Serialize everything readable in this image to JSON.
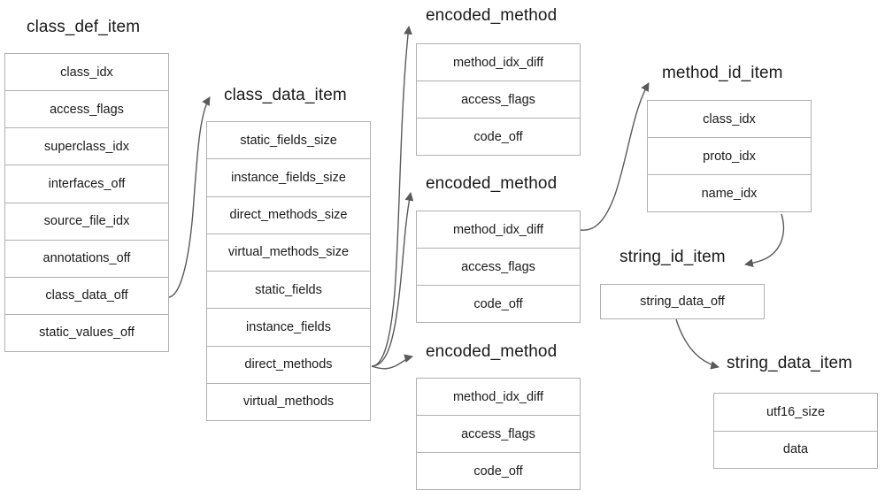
{
  "diagram": {
    "title_hidden": "",
    "accent_line_color": "#5a5a5a",
    "box_border_color": "#b0b0b0",
    "text_color": "#1a1a1a"
  },
  "structs": [
    {
      "id": "class_def_item",
      "title": "class_def_item",
      "fields": [
        "class_idx",
        "access_flags",
        "superclass_idx",
        "interfaces_off",
        "source_file_idx",
        "annotations_off",
        "class_data_off",
        "static_values_off"
      ]
    },
    {
      "id": "class_data_item",
      "title": "class_data_item",
      "fields": [
        "static_fields_size",
        "instance_fields_size",
        "direct_methods_size",
        "virtual_methods_size",
        "static_fields",
        "instance_fields",
        "direct_methods",
        "virtual_methods"
      ]
    },
    {
      "id": "encoded_method_1",
      "title": "encoded_method",
      "fields": [
        "method_idx_diff",
        "access_flags",
        "code_off"
      ]
    },
    {
      "id": "encoded_method_2",
      "title": "encoded_method",
      "fields": [
        "method_idx_diff",
        "access_flags",
        "code_off"
      ]
    },
    {
      "id": "encoded_method_3",
      "title": "encoded_method",
      "fields": [
        "method_idx_diff",
        "access_flags",
        "code_off"
      ]
    },
    {
      "id": "method_id_item",
      "title": "method_id_item",
      "fields": [
        "class_idx",
        "proto_idx",
        "name_idx"
      ]
    },
    {
      "id": "string_id_item",
      "title": "string_id_item",
      "fields": [
        "string_data_off"
      ]
    },
    {
      "id": "string_data_item",
      "title": "string_data_item",
      "fields": [
        "utf16_size",
        "data"
      ]
    }
  ],
  "connections": [
    {
      "from": "class_def_item.class_data_off",
      "to": "class_data_item"
    },
    {
      "from": "class_data_item.direct_methods",
      "to": "encoded_method_1"
    },
    {
      "from": "class_data_item.direct_methods",
      "to": "encoded_method_2"
    },
    {
      "from": "class_data_item.direct_methods",
      "to": "encoded_method_3"
    },
    {
      "from": "encoded_method_2.method_idx_diff",
      "to": "method_id_item"
    },
    {
      "from": "method_id_item.name_idx",
      "to": "string_id_item"
    },
    {
      "from": "string_id_item.string_data_off",
      "to": "string_data_item"
    }
  ]
}
